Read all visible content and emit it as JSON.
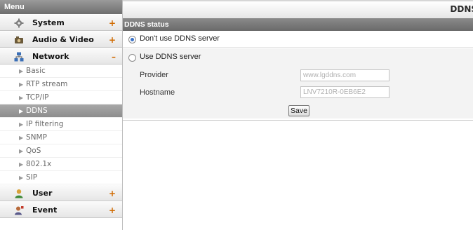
{
  "sidebar": {
    "header": "Menu",
    "system": {
      "label": "System",
      "toggle": "+"
    },
    "audio_video": {
      "label": "Audio & Video",
      "toggle": "+"
    },
    "network": {
      "label": "Network",
      "toggle": "–",
      "items": [
        "Basic",
        "RTP stream",
        "TCP/IP",
        "DDNS",
        "IP filtering",
        "SNMP",
        "QoS",
        "802.1x",
        "SIP"
      ],
      "active": "DDNS"
    },
    "user": {
      "label": "User",
      "toggle": "+"
    },
    "event": {
      "label": "Event",
      "toggle": "+"
    }
  },
  "main": {
    "title": "DDNS",
    "section": "DDNS status",
    "option_no_ddns": "Don't use DDNS server",
    "option_use_ddns": "Use DDNS server",
    "selected_option": "Don't use DDNS server",
    "provider_label": "Provider",
    "provider_value": "www.lgddns.com",
    "hostname_label": "Hostname",
    "hostname_value": "LNV7210R-0EB6E2",
    "save_label": "Save"
  },
  "colors": {
    "menu_header_bg": "#7f7f7f",
    "toggle_color": "#d06a00",
    "active_item_bg": "#999999",
    "radio_selected": "#3a72c8"
  },
  "icons": {
    "system": "gear-icon",
    "audio_video": "camera-icon",
    "network": "network-icon",
    "user": "user-icon",
    "event": "event-icon",
    "submenu_arrow": "triangle-right-icon"
  }
}
